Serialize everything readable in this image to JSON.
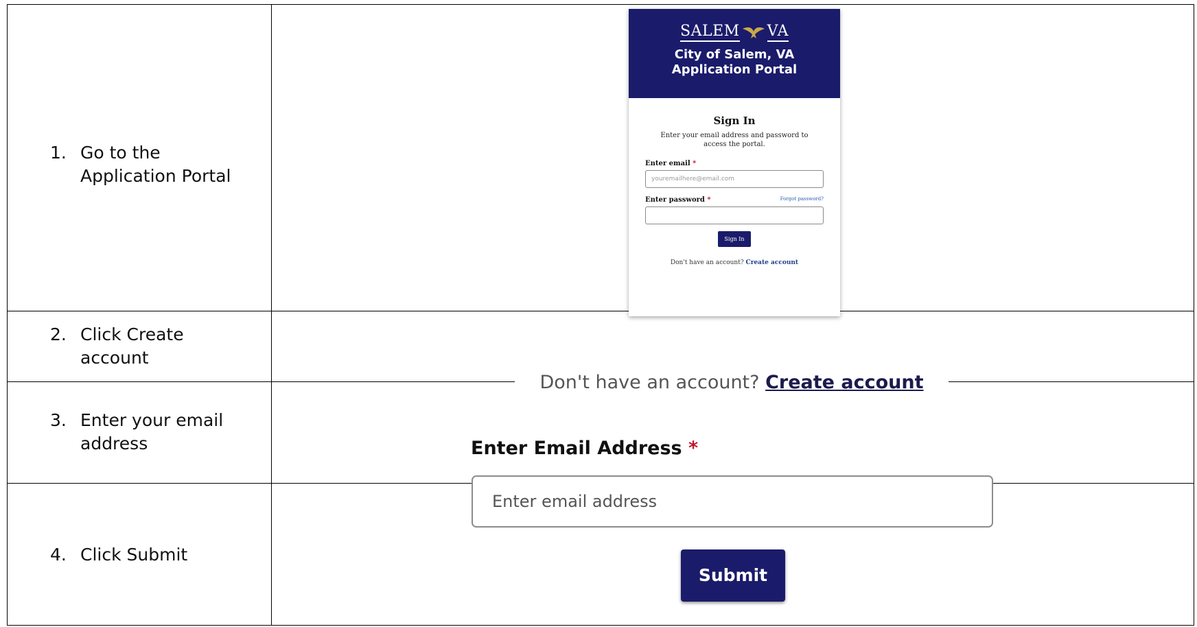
{
  "steps": [
    {
      "number": "1.",
      "text": "Go to the Application Portal"
    },
    {
      "number": "2.",
      "text": "Click Create account"
    },
    {
      "number": "3.",
      "text": "Enter your email address"
    },
    {
      "number": "4.",
      "text": "Click Submit"
    }
  ],
  "signin": {
    "logo_left": "SALEM",
    "logo_right": "VA",
    "portal_title_line1": "City of Salem, VA",
    "portal_title_line2": "Application Portal",
    "heading": "Sign In",
    "subtext": "Enter your email address and password to access the portal.",
    "email_label": "Enter email",
    "email_placeholder": "youremailhere@email.com",
    "password_label": "Enter password",
    "forgot_link": "Forgot password?",
    "required_mark": "*",
    "signin_button": "Sign In",
    "no_account_text": "Don't have an account?",
    "create_account_link": "Create account"
  },
  "create_account_shot": {
    "no_account_text": "Don't have an account?",
    "create_account_link": "Create account"
  },
  "email_shot": {
    "label": "Enter Email Address",
    "required_mark": "*",
    "placeholder": "Enter email address"
  },
  "submit_shot": {
    "label": "Submit"
  },
  "colors": {
    "brand_navy": "#1b1b6b",
    "required_red": "#c0152a",
    "link_blue": "#2a5db0"
  }
}
